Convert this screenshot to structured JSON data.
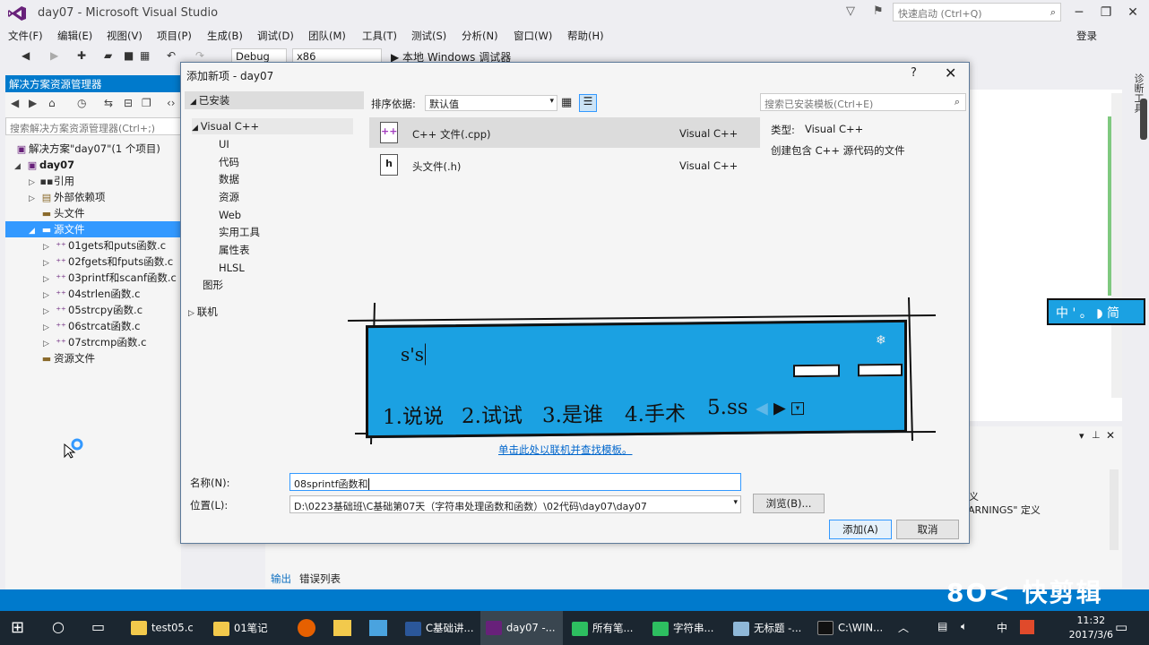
{
  "window": {
    "title": "day07 - Microsoft Visual Studio",
    "quick_launch_placeholder": "快速启动 (Ctrl+Q)",
    "signin": "登录"
  },
  "menu": [
    "文件(F)",
    "编辑(E)",
    "视图(V)",
    "项目(P)",
    "生成(B)",
    "调试(D)",
    "团队(M)",
    "工具(T)",
    "测试(S)",
    "分析(N)",
    "窗口(W)",
    "帮助(H)"
  ],
  "toolbar": {
    "config": "Debug",
    "platform": "x86",
    "run_label": "▶ 本地 Windows 调试器"
  },
  "solution_explorer": {
    "header": "解决方案资源管理器",
    "search_placeholder": "搜索解决方案资源管理器(Ctrl+;)",
    "items": [
      {
        "label": "解决方案\"day07\"(1 个项目)"
      },
      {
        "label": "day07"
      },
      {
        "label": "引用"
      },
      {
        "label": "外部依赖项"
      },
      {
        "label": "头文件"
      },
      {
        "label": "源文件"
      },
      {
        "label": "01gets和puts函数.c"
      },
      {
        "label": "02fgets和fputs函数.c"
      },
      {
        "label": "03printf和scanf函数.c"
      },
      {
        "label": "04strlen函数.c"
      },
      {
        "label": "05strcpy函数.c"
      },
      {
        "label": "06strcat函数.c"
      },
      {
        "label": "07strcmp函数.c"
      },
      {
        "label": "资源文件"
      }
    ]
  },
  "output_panel": {
    "tab_output": "输出",
    "tab_errors": "错误列表",
    "line1": "定义",
    "line2": "ARNINGS\" 定义"
  },
  "side_toolbox": "诊断工具",
  "dialog": {
    "title": "添加新项 - day07",
    "help": "?",
    "installed": "已安装",
    "categories": {
      "root": "Visual C++",
      "subs": [
        "UI",
        "代码",
        "数据",
        "资源",
        "Web",
        "实用工具",
        "属性表",
        "HLSL"
      ],
      "graphics": "图形",
      "online": "联机"
    },
    "sort_label": "排序依据:",
    "sort_value": "默认值",
    "search_placeholder": "搜索已安装模板(Ctrl+E)",
    "templates": [
      {
        "icon": "++",
        "name": "C++ 文件(.cpp)",
        "type": "Visual C++"
      },
      {
        "icon": "h",
        "name": "头文件(.h)",
        "type": "Visual C++"
      }
    ],
    "detail_type_label": "类型:",
    "detail_type_value": "Visual C++",
    "detail_desc": "创建包含 C++ 源代码的文件",
    "online_link": "单击此处以联机并查找模板。",
    "name_label": "名称(N):",
    "name_value": "08sprintf函数和",
    "location_label": "位置(L):",
    "location_value": "D:\\0223基础班\\C基础第07天（字符串处理函数和函数）\\02代码\\day07\\day07",
    "browse_button": "浏览(B)...",
    "add_button": "添加(A)",
    "cancel_button": "取消"
  },
  "ime": {
    "composition": "s's",
    "candidates": [
      "1.说说",
      "2.试试",
      "3.是谁",
      "4.手术",
      "5.ss"
    ],
    "status": "中 ' 。 ◗ 简"
  },
  "watermark": "8O< 快剪辑",
  "taskbar": {
    "tasks": [
      "test05.c",
      "01笔记",
      "C基础讲...",
      "day07 -...",
      "所有笔...",
      "字符串...",
      "无标题 -...",
      "C:\\WIN..."
    ],
    "tray_ime": "中",
    "time": "11:32",
    "date": "2017/3/6"
  },
  "colors": {
    "accent": "#007acc",
    "selection": "#3399ff",
    "ime_bg": "#1ba1e2",
    "taskbar": "#1b2630"
  }
}
